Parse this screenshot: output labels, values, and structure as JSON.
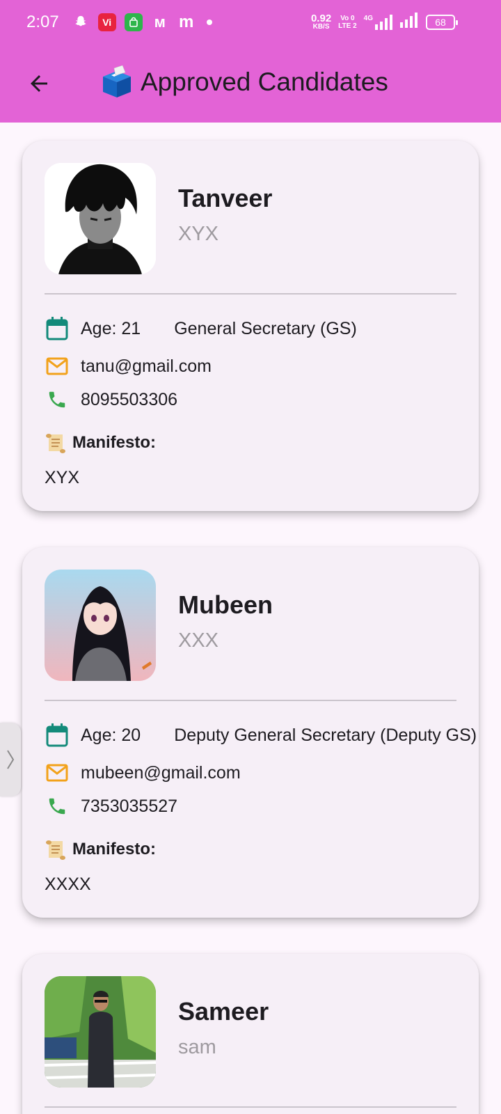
{
  "status_bar": {
    "time": "2:07",
    "net_speed_value": "0.92",
    "net_speed_unit": "KB/S",
    "volte_top": "Vo 0",
    "volte_bottom": "LTE 2",
    "network": "4G",
    "battery": "68"
  },
  "app_bar": {
    "title": "Approved Candidates",
    "back_icon": "arrow-left-icon",
    "title_icon": "ballot-box-icon"
  },
  "labels": {
    "manifesto": "Manifesto:"
  },
  "candidates": [
    {
      "name": "Tanveer",
      "nickname": "XYX",
      "age": "Age: 21",
      "position": "General Secretary (GS)",
      "email": "tanu@gmail.com",
      "phone": "8095503306",
      "manifesto": "XYX"
    },
    {
      "name": "Mubeen",
      "nickname": "XXX",
      "age": "Age: 20",
      "position": "Deputy General Secretary (Deputy GS)",
      "email": "mubeen@gmail.com",
      "phone": "7353035527",
      "manifesto": "XXXX"
    },
    {
      "name": "Sameer",
      "nickname": "sam"
    }
  ],
  "colors": {
    "app_bar": "#e363d6",
    "background": "#fdf6fd",
    "card": "#f6eff7",
    "calendar_icon": "#138a7a",
    "mail_icon": "#f2a21b",
    "phone_icon": "#3aa84f"
  }
}
